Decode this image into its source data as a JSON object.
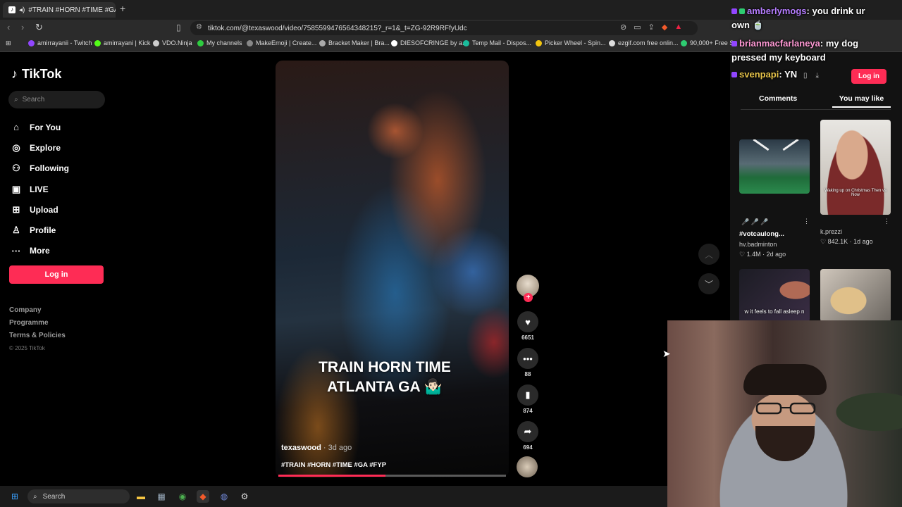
{
  "browser": {
    "tab_title": "#TRAIN #HORN #TIME #GA",
    "url": "tiktok.com/@texaswood/video/7585599476564348215?_r=1&_t=ZG-92R9RFfyUdc",
    "bookmarks": [
      {
        "label": "amirrayanii - Twitch",
        "color": "#9146ff"
      },
      {
        "label": "amirrayani | Kick",
        "color": "#53fc18"
      },
      {
        "label": "VDO.Ninja",
        "color": "#cccccc"
      },
      {
        "label": "My channels",
        "color": "#2ecc40"
      },
      {
        "label": "MakeEmoji | Create...",
        "color": "#888888"
      },
      {
        "label": "Bracket Maker | Bra...",
        "color": "#aaaaaa"
      },
      {
        "label": "DIESOFCRINGE by a...",
        "color": "#ffffff"
      },
      {
        "label": "Temp Mail - Dispos...",
        "color": "#1abc9c"
      },
      {
        "label": "Picker Wheel - Spin...",
        "color": "#f1c40f"
      },
      {
        "label": "ezgif.com free onlin...",
        "color": "#dddddd"
      },
      {
        "label": "90,000+ Free So",
        "color": "#2ecc71"
      }
    ]
  },
  "tiktok": {
    "brand": "TikTok",
    "search_placeholder": "Search",
    "nav": [
      {
        "label": "For You",
        "icon": "home-icon",
        "glyph": "⌂"
      },
      {
        "label": "Explore",
        "icon": "compass-icon",
        "glyph": "◎"
      },
      {
        "label": "Following",
        "icon": "person-follow-icon",
        "glyph": "⚇"
      },
      {
        "label": "LIVE",
        "icon": "live-icon",
        "glyph": "▣"
      },
      {
        "label": "Upload",
        "icon": "upload-icon",
        "glyph": "⊞"
      },
      {
        "label": "Profile",
        "icon": "profile-icon",
        "glyph": "♙"
      },
      {
        "label": "More",
        "icon": "more-icon",
        "glyph": "···"
      }
    ],
    "login_label": "Log in",
    "footer": {
      "company": "Company",
      "programme": "Programme",
      "terms": "Terms & Policies",
      "copyright": "© 2025 TikTok"
    },
    "video": {
      "overlay_line1": "TRAIN HORN TIME",
      "overlay_line2": "ATLANTA  GA 🤷🏻‍♂️",
      "author": "texaswood",
      "ago": " · 3d ago",
      "hashtags": "#TRAIN #HORN #TIME #GA #FYP",
      "progress_fraction": 0.47
    },
    "actions": {
      "likes": "6651",
      "comments": "88",
      "saves": "874",
      "shares": "694"
    },
    "panel": {
      "tab_comments": "Comments",
      "tab_you_may_like": "You may like",
      "cards": [
        {
          "title": "#votcaulong...",
          "author": "hv.badminton",
          "meta": "♡ 1.4M · 2d ago"
        },
        {
          "title": "",
          "author": "k.prezzi",
          "meta": "♡ 842.1K · 1d ago",
          "caption": "Waking up on Christmas Then vs Now"
        },
        {
          "caption": "w it feels to fall asleep n"
        },
        {
          "caption": ""
        }
      ]
    }
  },
  "chat": [
    {
      "user": "amberlymogs",
      "user_color": "#b57dff",
      "msg": ": you drink ur"
    },
    {
      "user": "",
      "user_color": "#ffffff",
      "msg": "own 🍵"
    },
    {
      "user": "brianmacfarlaneya",
      "user_color": "#ff9ad5",
      "msg": ": my dog"
    },
    {
      "user": "",
      "user_color": "#ffffff",
      "msg": "pressed my keyboard"
    },
    {
      "user": "svenpapi",
      "user_color": "#e6c34a",
      "msg": ": YN"
    }
  ],
  "taskbar": {
    "search_label": "Search"
  }
}
